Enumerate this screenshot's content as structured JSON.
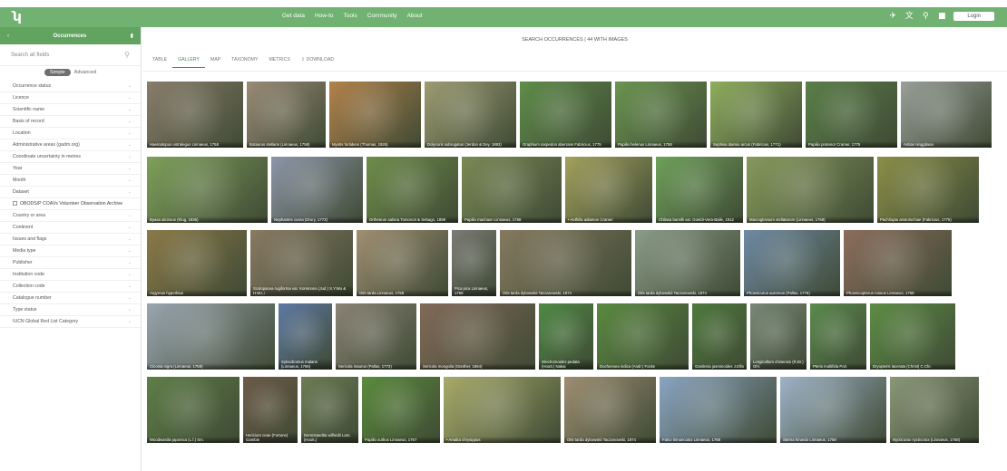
{
  "header": {
    "logo_icon": "gbif-logo",
    "nav": [
      "Get data",
      "How-to",
      "Tools",
      "Community",
      "About"
    ],
    "icons": [
      "flight-icon",
      "translate-icon",
      "search-icon",
      "message-icon"
    ],
    "login": "Login"
  },
  "sidebar": {
    "back_icon": "chevron-left-icon",
    "title": "Occurrences",
    "search_placeholder": "Search all fields",
    "mode_on": "Simple",
    "mode_off": "Advanced",
    "filters": [
      "Occurrence status",
      "Licence",
      "Scientific name",
      "Basis of record",
      "Location",
      "Administrative areas (gadm.org)",
      "Coordinate uncertainty in metres",
      "Year",
      "Month",
      "Dataset"
    ],
    "dataset_value": "OBODS/P COAVs Volunteer Observation Archive",
    "filters2": [
      "Country or area",
      "Continent",
      "Issues and flags",
      "Media type",
      "Publisher",
      "Institution code",
      "Collection code",
      "Catalogue number",
      "Type status",
      "IUCN Global Red List Category"
    ]
  },
  "main": {
    "header": "SEARCH OCCURRENCES  |  44 WITH IMAGES",
    "tabs": [
      "TABLE",
      "GALLERY",
      "MAP",
      "TAXONOMY",
      "METRICS",
      "⇩ DOWNLOAD"
    ],
    "active_tab": "GALLERY",
    "rows": [
      [
        {
          "cap": "Haematopus ostralegus Linnaeus, 1758",
          "color": "#8a7d6b"
        },
        {
          "cap": "Botaurus stellaris (Linnaeus, 1758)",
          "color": "#9a8b76"
        },
        {
          "cap": "Myotis fortidens (Thomas, 1926)",
          "color": "#b3824a"
        },
        {
          "cap": "Dolycoris subrugatus (Jerdon & Dey, 1893)",
          "color": "#9d9c72"
        },
        {
          "cap": "Graphium sarpedon aberrans Fabricius, 1775",
          "color": "#5f8d4a"
        },
        {
          "cap": "Papilio helenus Linnaeus, 1758",
          "color": "#6b9550"
        },
        {
          "cap": "Sephisa daimio arcus (Fabricius, 1771)",
          "color": "#8fae5d"
        },
        {
          "cap": "Papilio protenor Cramer, 1775",
          "color": "#5a7f48"
        },
        {
          "cap": "Antias ninggliana",
          "color": "#9aa09a"
        }
      ],
      [
        {
          "cap": "Byasa alcinous (Klug, 1836)",
          "color": "#7fa05a"
        },
        {
          "cap": "Nephantes curea (Drury, 1773)",
          "color": "#8d96a8"
        },
        {
          "cap": "Orthetrum sabina Tomonori & Sebago, 1898",
          "color": "#6f8d4a"
        },
        {
          "cap": "Papilio machaon Linnaeus, 1758",
          "color": "#7a8a55"
        },
        {
          "cap": "• Aethilla adianton Cramer",
          "color": "#a3a15c"
        },
        {
          "cap": "Chilasa bareilli var. Goeldi-Vera-Baile, 1912",
          "color": "#6ea15a"
        },
        {
          "cap": "Macroglossum stellatarum (Linnaeus, 1758)",
          "color": "#879a5b"
        },
        {
          "cap": "Pachliopta aristolochiae (Fabricius, 1775)",
          "color": "#8b8f47"
        }
      ],
      [
        {
          "cap": "Argyreus hyperbius",
          "color": "#8c7a48"
        },
        {
          "cap": "Scolopacea rugiforma var. Kommona (Jud.) S.Y.Wu & H.W.Li",
          "color": "#8a7a62"
        },
        {
          "cap": "Otis tarda Linnaeus, 1758",
          "color": "#a08f72"
        },
        {
          "cap": "Pica pica Linnaeus, 1758",
          "color": "#7b7b74"
        },
        {
          "cap": "Otis tarda dybowskii Taczanowski, 1874",
          "color": "#857a5f"
        },
        {
          "cap": "Otis tarda dybowskii Taczanowski, 1874",
          "color": "#8b9c88"
        },
        {
          "cap": "Phoenicurus auroreus (Pallas, 1776)",
          "color": "#6f8aa4"
        },
        {
          "cap": "Phoenicopterus roseus Linnaeus, 1758",
          "color": "#8c6d5c"
        }
      ],
      [
        {
          "cap": "Ciconia nigra (Linnaeus, 1758)",
          "color": "#9aa6b0"
        },
        {
          "cap": "Sylvodromus malaris (Linnaeus, 1766)",
          "color": "#5e7aa4"
        },
        {
          "cap": "Sericola maurus (Pallas, 1773)",
          "color": "#8a8476"
        },
        {
          "cap": "Sericola mongolia (Günther, 1864)",
          "color": "#826a58"
        },
        {
          "cap": "Glechomoides pedata (Houtt.) Nakai",
          "color": "#4f8a45"
        },
        {
          "cap": "Duchesnea indica (Andr.) Focke",
          "color": "#5a8a40"
        },
        {
          "cap": "Gardenia jasminoides J.Ellis",
          "color": "#4e7a3c"
        },
        {
          "cap": "Longicollum chinensis (R.Br.) Ohl.",
          "color": "#7a8a78"
        },
        {
          "cap": "Pteris multifida Poir.",
          "color": "#5a8b4d"
        },
        {
          "cap": "Dryopteris lacerata (Christ) C.Chr.",
          "color": "#5d8d45"
        }
      ],
      [
        {
          "cap": "Woodwardia japonica (L.f.) Sm.",
          "color": "#5f7e48"
        },
        {
          "cap": "Hericium ceae (Fortune) Gambie",
          "color": "#6e5a48"
        },
        {
          "cap": "Dennstaedtia wilfordii Lam. (Hook.)",
          "color": "#6d7d55"
        },
        {
          "cap": "Papilio xuthus Linnaeus, 1767",
          "color": "#5b8c3c"
        },
        {
          "cap": "• Amaka chrysippus",
          "color": "#a8ab6a"
        },
        {
          "cap": "Otis tarda dybowskii Taczanowski, 1874",
          "color": "#9e8e72"
        },
        {
          "cap": "Falco tinnunculus Linnaeus, 1758",
          "color": "#8aa5c2"
        },
        {
          "cap": "Sterna hirundo Linnaeus, 1758",
          "color": "#9eb3c8"
        },
        {
          "cap": "Nycticorax nycticorax (Linnaeus, 1758)",
          "color": "#8b9878"
        }
      ]
    ]
  }
}
